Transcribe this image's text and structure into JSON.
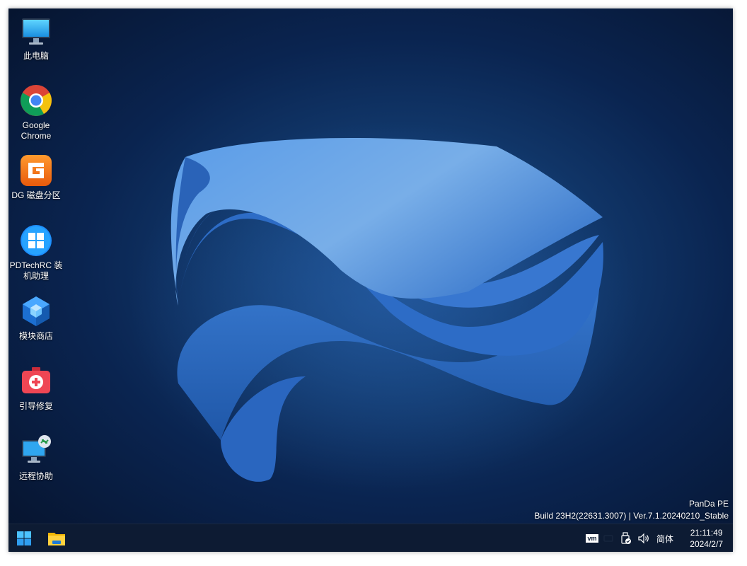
{
  "desktop": {
    "icons": [
      {
        "label": "此电脑",
        "icon": "computer-icon"
      },
      {
        "label": "Google Chrome",
        "icon": "chrome-icon"
      },
      {
        "label": "DG 磁盘分区",
        "icon": "diskgenius-icon"
      },
      {
        "label": "PDTechRC 装机助理",
        "icon": "windows-installer-icon"
      },
      {
        "label": "模块商店",
        "icon": "module-store-icon"
      },
      {
        "label": "引导修复",
        "icon": "boot-repair-icon"
      },
      {
        "label": "远程协助",
        "icon": "remote-assist-icon"
      }
    ],
    "watermark": {
      "line1": "PanDa PE",
      "line2": "Build 23H2(22631.3007) | Ver.7.1.20240210_Stable"
    }
  },
  "taskbar": {
    "start_icon": "windows-start-icon",
    "pinned": [
      {
        "icon": "file-explorer-icon"
      }
    ],
    "tray": {
      "vm_label": "vm",
      "ime_label": "简体",
      "time": "21:11:49",
      "date": "2024/2/7"
    }
  },
  "colors": {
    "desktop_bg": "#0a2450",
    "ribbon": "#3a7bd5",
    "taskbar_bg": "#0d1b33"
  }
}
